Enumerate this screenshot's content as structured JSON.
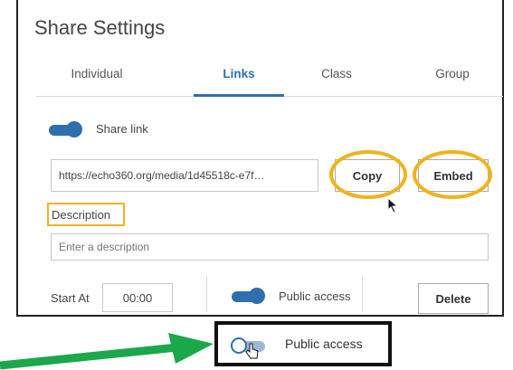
{
  "window": {
    "title": "Share Settings"
  },
  "tabs": [
    {
      "label": "Individual"
    },
    {
      "label": "Links",
      "active": true
    },
    {
      "label": "Class"
    },
    {
      "label": "Group"
    }
  ],
  "share_link": {
    "label": "Share link",
    "enabled": true
  },
  "link": {
    "url": "https://echo360.org/media/1d45518c-e7f…",
    "copy_label": "Copy",
    "embed_label": "Embed"
  },
  "description": {
    "label": "Description",
    "placeholder": "Enter a description",
    "value": ""
  },
  "start_at": {
    "label": "Start At",
    "value": "00:00"
  },
  "public_access": {
    "label": "Public access",
    "enabled": true
  },
  "delete_label": "Delete",
  "callout": {
    "label": "Public access",
    "enabled": false
  },
  "colors": {
    "accent": "#2f6fad",
    "highlight": "#f2b21c",
    "arrow": "#1aa84b"
  }
}
